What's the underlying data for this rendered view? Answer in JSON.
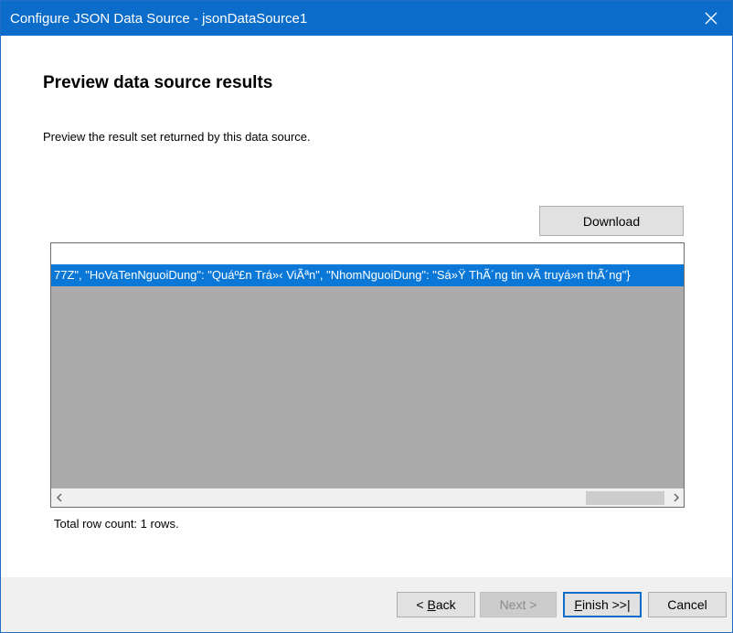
{
  "window": {
    "title": "Configure JSON Data Source - jsonDataSource1",
    "close_glyph": "close-icon"
  },
  "page": {
    "heading": "Preview data source results",
    "description": "Preview the result set returned by this data source."
  },
  "toolbar": {
    "download_label": "Download"
  },
  "grid": {
    "rows": [
      "77Z\",  \"HoVaTenNguoiDung\": \"Quáº£n Trá»‹ ViÃªn\",  \"NhomNguoiDung\": \"Sá»Ÿ ThÃ´ng tin vÃ  truyá»n thÃ´ng\"}"
    ],
    "row_count_text": "Total row count: 1 rows."
  },
  "footer": {
    "back_prefix": "< ",
    "back_key": "B",
    "back_rest": "ack",
    "next_label": "Next >",
    "finish_key": "F",
    "finish_rest": "inish >>|",
    "cancel_label": "Cancel"
  }
}
